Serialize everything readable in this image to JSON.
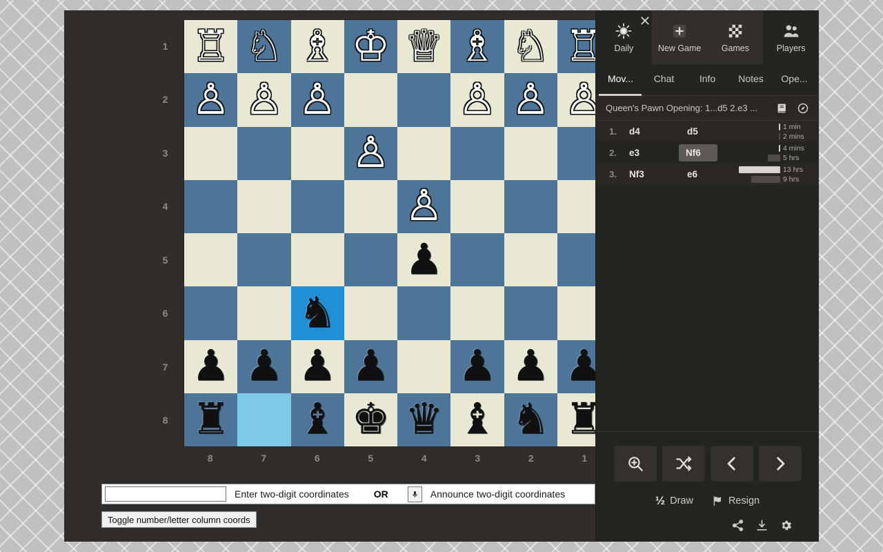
{
  "app": {
    "board_gear_icon": "gear-icon"
  },
  "board": {
    "rank_labels": [
      "1",
      "2",
      "3",
      "4",
      "5",
      "6",
      "7",
      "8"
    ],
    "file_labels": [
      "8",
      "7",
      "6",
      "5",
      "4",
      "3",
      "2",
      "1"
    ],
    "light_color": "#e9e9d3",
    "dark_color": "#4d7599",
    "highlight_move_color": "#1f8fd6",
    "highlight_origin_color": "#7dc9e8",
    "rows": [
      [
        "wR",
        "wN",
        "wB",
        "wK",
        "wQ",
        "wB",
        "wN",
        "wR"
      ],
      [
        "wP",
        "wP",
        "wP",
        "",
        "",
        "wP",
        "wP",
        "wP"
      ],
      [
        "",
        "",
        "",
        "wP",
        "",
        "",
        "",
        ""
      ],
      [
        "",
        "",
        "",
        "",
        "wP",
        "",
        "",
        ""
      ],
      [
        "",
        "",
        "",
        "",
        "bP",
        "",
        "",
        ""
      ],
      [
        "",
        "",
        "bN",
        "",
        "",
        "",
        "",
        ""
      ],
      [
        "bP",
        "bP",
        "bP",
        "bP",
        "",
        "bP",
        "bP",
        "bP"
      ],
      [
        "bR",
        "",
        "bB",
        "bK",
        "bQ",
        "bB",
        "bN",
        "bR"
      ]
    ],
    "highlights": {
      "move": [
        5,
        2
      ],
      "origin": [
        7,
        1
      ]
    }
  },
  "input_bar": {
    "coord_value": "",
    "coord_placeholder": "",
    "enter_label": "Enter two-digit coordinates",
    "or_label": "OR",
    "mic_icon": "microphone-icon",
    "announce_label": "Announce two-digit coordinates",
    "toggle_button": "Toggle number/letter column coords"
  },
  "topnav": {
    "close_icon": "close-icon",
    "items": [
      {
        "label": "Daily",
        "icon": "sun-icon"
      },
      {
        "label": "New Game",
        "icon": "plus-square-icon"
      },
      {
        "label": "Games",
        "icon": "chessboard-icon"
      },
      {
        "label": "Players",
        "icon": "people-icon"
      }
    ]
  },
  "subtabs": {
    "items": [
      {
        "label": "Mov...",
        "active": true
      },
      {
        "label": "Chat",
        "active": false
      },
      {
        "label": "Info",
        "active": false
      },
      {
        "label": "Notes",
        "active": false
      },
      {
        "label": "Ope...",
        "active": false
      }
    ]
  },
  "opening": {
    "text": "Queen's Pawn Opening: 1...d5 2.e3 ...",
    "book_icon": "book-icon",
    "explore_icon": "compass-icon"
  },
  "moves": [
    {
      "number": "1.",
      "white": "d4",
      "black": "d5",
      "white_highlight": false,
      "black_highlight": false,
      "white_time": "1 min",
      "black_time": "2 mins",
      "white_bar_pct": 2,
      "black_bar_pct": 2
    },
    {
      "number": "2.",
      "white": "e3",
      "black": "Nf6",
      "white_highlight": false,
      "black_highlight": true,
      "white_time": "4 mins",
      "black_time": "5 hrs",
      "white_bar_pct": 2,
      "black_bar_pct": 22
    },
    {
      "number": "3.",
      "white": "Nf3",
      "black": "e6",
      "white_highlight": false,
      "black_highlight": false,
      "white_time": "13 hrs",
      "black_time": "9 hrs",
      "white_bar_pct": 75,
      "black_bar_pct": 52
    }
  ],
  "controls": {
    "buttons": [
      {
        "name": "analysis",
        "icon": "magnify-plus-icon"
      },
      {
        "name": "share-move",
        "icon": "shuffle-icon"
      },
      {
        "name": "previous-move",
        "icon": "chevron-left-icon"
      },
      {
        "name": "next-move",
        "icon": "chevron-right-icon"
      }
    ],
    "draw_label": "Draw",
    "draw_symbol": "½",
    "resign_label": "Resign",
    "resign_icon": "flag-icon",
    "small_icons": [
      {
        "name": "share-icon"
      },
      {
        "name": "download-icon"
      },
      {
        "name": "settings-gear-icon"
      }
    ]
  }
}
